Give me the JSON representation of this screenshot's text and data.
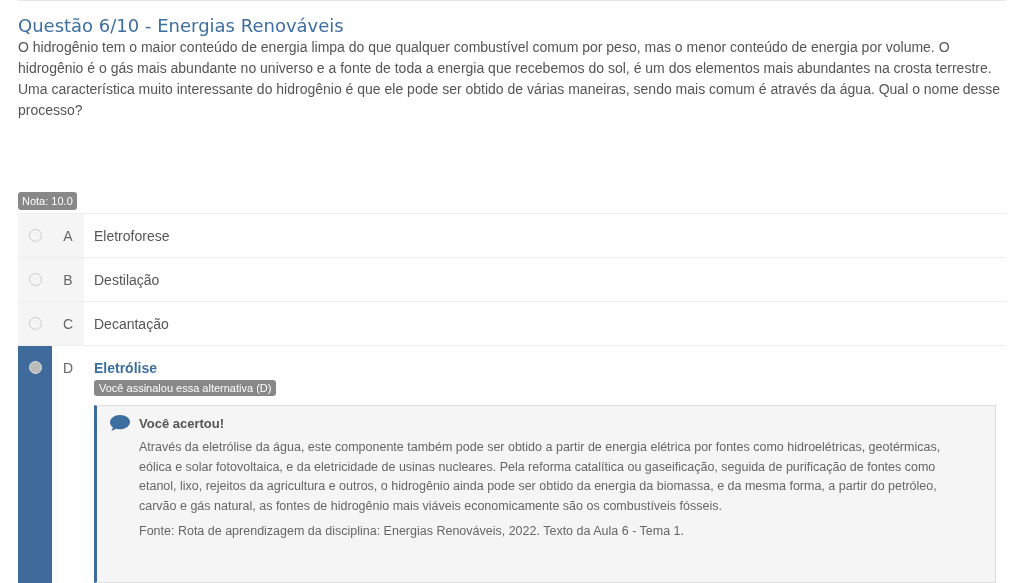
{
  "question": {
    "title": "Questão 6/10 - Energias Renováveis",
    "text": "O hidrogênio tem o maior conteúdo de energia limpa do que qualquer combustível comum por peso, mas o menor conteúdo de energia por volume. O hidrogênio é o gás mais abundante no universo e a fonte de toda a energia que recebemos do sol, é um dos elementos mais abundantes na crosta terrestre. Uma característica muito interessante do hidrogênio é que ele pode ser obtido de várias maneiras, sendo mais comum é através da água. Qual o nome desse processo?"
  },
  "grade_badge": "Nota: 10.0",
  "options": [
    {
      "letter": "A",
      "text": "Eletroforese",
      "selected": false
    },
    {
      "letter": "B",
      "text": "Destilação",
      "selected": false
    },
    {
      "letter": "C",
      "text": "Decantação",
      "selected": false
    },
    {
      "letter": "D",
      "text": "Eletrólise",
      "selected": true,
      "marked_badge": "Você assinalou essa alternativa (D)",
      "feedback": {
        "title": "Você acertou!",
        "paragraphs": [
          "Através da eletrólise da água, este componente também pode ser obtido a partir de energia elétrica por fontes como hidroelétricas, geotérmicas, eólica e solar fotovoltaica, e da eletricidade de usinas nucleares. Pela reforma catalítica ou gaseificação, seguida de purificação de fontes como etanol, lixo, rejeitos da agricultura e outros, o hidrogênio ainda pode ser obtido da energia da biomassa, e da mesma forma, a partir do petróleo, carvão e gás natural, as fontes de hidrogênio mais viáveis economicamente são os combustíveis fósseis.",
          "Fonte: Rota de aprendizagem da disciplina: Energias Renováveis, 2022. Texto da Aula 6 - Tema 1."
        ]
      }
    }
  ]
}
